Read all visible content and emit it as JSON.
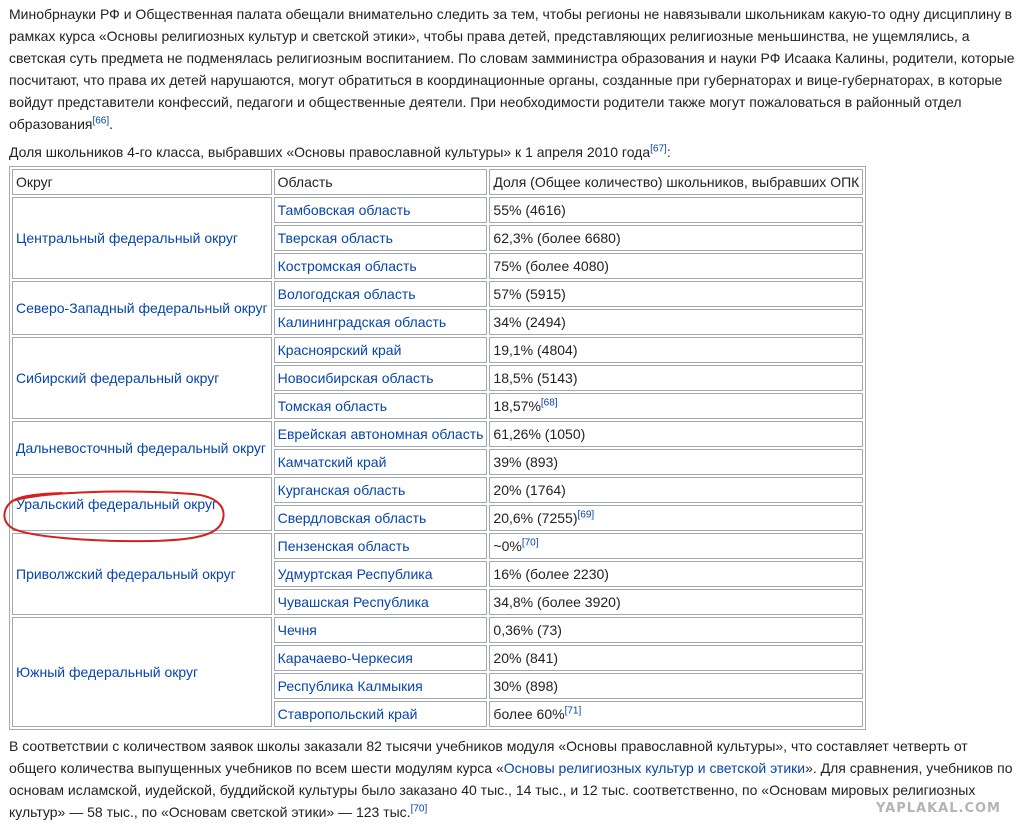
{
  "intro": {
    "text": "Минобрнауки РФ и Общественная палата обещали внимательно следить за тем, чтобы регионы не навязывали школьникам какую-то одну дисциплину в рамках курса «Основы религиозных культур и светской этики», чтобы права детей, представляющих религиозные меньшинства, не ущемлялись, а светская суть предмета не подменялась религиозным воспитанием. По словам замминистра образования и науки РФ Исаака Калины, родители, которые посчитают, что права их детей нарушаются, могут обратиться в координационные органы, созданные при губернаторах и вице-губернаторах, в которые войдут представители конфессий, педагоги и общественные деятели. При необходимости родители также могут пожаловаться в районный отдел образования",
    "ref": "[66]",
    "end": "."
  },
  "caption": {
    "text": "Доля школьников 4-го класса, выбравших «Основы православной культуры» к 1 апреля 2010 года",
    "ref": "[67]",
    "end": ":"
  },
  "table": {
    "headers": [
      "Округ",
      "Область",
      "Доля (Общее количество) школьников, выбравших ОПК"
    ],
    "groups": [
      {
        "district": "Центральный федеральный округ",
        "rows": [
          {
            "region": "Тамбовская область",
            "share": "55% (4616)",
            "ref": ""
          },
          {
            "region": "Тверская область",
            "share": "62,3% (более 6680)",
            "ref": ""
          },
          {
            "region": "Костромская область",
            "share": "75% (более 4080)",
            "ref": ""
          }
        ]
      },
      {
        "district": "Северо-Западный федеральный округ",
        "rows": [
          {
            "region": "Вологодская область",
            "share": "57% (5915)",
            "ref": ""
          },
          {
            "region": "Калининградская область",
            "share": "34% (2494)",
            "ref": ""
          }
        ]
      },
      {
        "district": "Сибирский федеральный округ",
        "rows": [
          {
            "region": "Красноярский край",
            "share": "19,1% (4804)",
            "ref": ""
          },
          {
            "region": "Новосибирская область",
            "share": "18,5% (5143)",
            "ref": ""
          },
          {
            "region": "Томская область",
            "share": "18,57%",
            "ref": "[68]"
          }
        ]
      },
      {
        "district": "Дальневосточный федеральный округ",
        "rows": [
          {
            "region": "Еврейская автономная область",
            "share": "61,26% (1050)",
            "ref": ""
          },
          {
            "region": "Камчатский край",
            "share": "39% (893)",
            "ref": ""
          }
        ]
      },
      {
        "district": "Уральский федеральный округ",
        "rows": [
          {
            "region": "Курганская область",
            "share": "20% (1764)",
            "ref": ""
          },
          {
            "region": "Свердловская область",
            "share": "20,6% (7255)",
            "ref": "[69]"
          }
        ]
      },
      {
        "district": "Приволжский федеральный округ",
        "rows": [
          {
            "region": "Пензенская область",
            "share": "~0%",
            "ref": "[70]"
          },
          {
            "region": "Удмуртская Республика",
            "share": "16% (более 2230)",
            "ref": ""
          },
          {
            "region": "Чувашская Республика",
            "share": "34,8% (более 3920)",
            "ref": ""
          }
        ]
      },
      {
        "district": "Южный федеральный округ",
        "rows": [
          {
            "region": "Чечня",
            "share": "0,36% (73)",
            "ref": ""
          },
          {
            "region": "Карачаево-Черкесия",
            "share": "20% (841)",
            "ref": ""
          },
          {
            "region": "Республика Калмыкия",
            "share": "30% (898)",
            "ref": ""
          },
          {
            "region": "Ставропольский край",
            "share": "более 60%",
            "ref": "[71]"
          }
        ]
      }
    ]
  },
  "outro": {
    "text_before": "В соответствии с количеством заявок школы заказали 82 тысячи учебников модуля «Основы православной культуры», что составляет четверть от общего количества выпущенных учебников по всем шести модулям курса «",
    "link": "Основы религиозных культур и светской этики",
    "text_after": "». Для сравнения, учебников по основам исламской, иудейской, буддийской культуры было заказано 40 тыс., 14 тыс., и 12 тыс. соответственно, по «Основам мировых религиозных культур» — 58 тыс., по «Основам светской этики» — 123 тыс.",
    "ref": "[70]"
  },
  "watermark": "YAPLAKAL.COM",
  "colors": {
    "link": "#0645ad",
    "text": "#222222",
    "border": "#a2a9b1",
    "annotation": "#d42020",
    "watermark": "#b4b4b4"
  }
}
